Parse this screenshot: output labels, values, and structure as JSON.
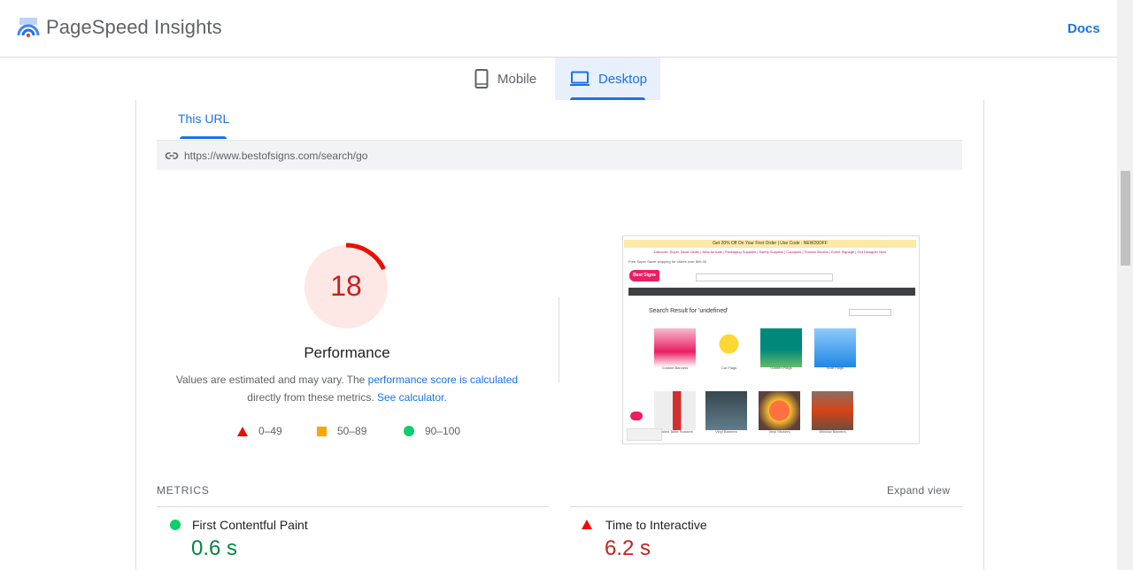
{
  "header": {
    "title": "PageSpeed Insights",
    "docs_label": "Docs"
  },
  "tabs": [
    {
      "label": "Mobile",
      "icon": "phone-icon"
    },
    {
      "label": "Desktop",
      "icon": "laptop-icon",
      "selected": true
    }
  ],
  "subtab": {
    "label": "This URL"
  },
  "url": "https://www.bestofsigns.com/search/go",
  "performance": {
    "score": "18",
    "score_value": 18,
    "title": "Performance",
    "desc_prefix": "Values are estimated and may vary. The ",
    "desc_link1": "performance score is calculated",
    "desc_middle": " directly from these metrics. ",
    "desc_link2": "See calculator",
    "desc_suffix": ".",
    "colors": {
      "fail": "#eb0f00",
      "average": "#ffa400",
      "pass": "#0cce6b",
      "fail_bg": "#fde8e6"
    }
  },
  "legend": [
    {
      "range": "0–49",
      "shape": "triangle"
    },
    {
      "range": "50–89",
      "shape": "square"
    },
    {
      "range": "90–100",
      "shape": "circle"
    }
  ],
  "screenshot": {
    "promo": "Get 20% Off On Your First Order | Use Code : NEW20OFF",
    "links": "Discover: Super Saver Deals | New Arrivals | Packaging Supplies | Safety Supplies | Canopies | Tension Booths | Event Signage | Get Designer Now",
    "shipping": "Free Super Saver shipping for orders over $99.00",
    "logo": "Best Signs",
    "heading": "Search Result for 'undefined'",
    "products": [
      {
        "label": "Custom Banners"
      },
      {
        "label": "Car Flags"
      },
      {
        "label": "Garden Flags"
      },
      {
        "label": "Boat Flags"
      },
      {
        "label": "Bedded Table Runners"
      },
      {
        "label": "Vinyl Banners"
      },
      {
        "label": "Vinyl Stickers"
      },
      {
        "label": "Window Banners"
      }
    ]
  },
  "metrics": {
    "title": "METRICS",
    "expand_label": "Expand view",
    "items": [
      {
        "name": "First Contentful Paint",
        "value": "0.6 s",
        "color": "#018642"
      },
      {
        "name": "Time to Interactive",
        "value": "6.2 s",
        "color": "#c5221f"
      }
    ]
  }
}
